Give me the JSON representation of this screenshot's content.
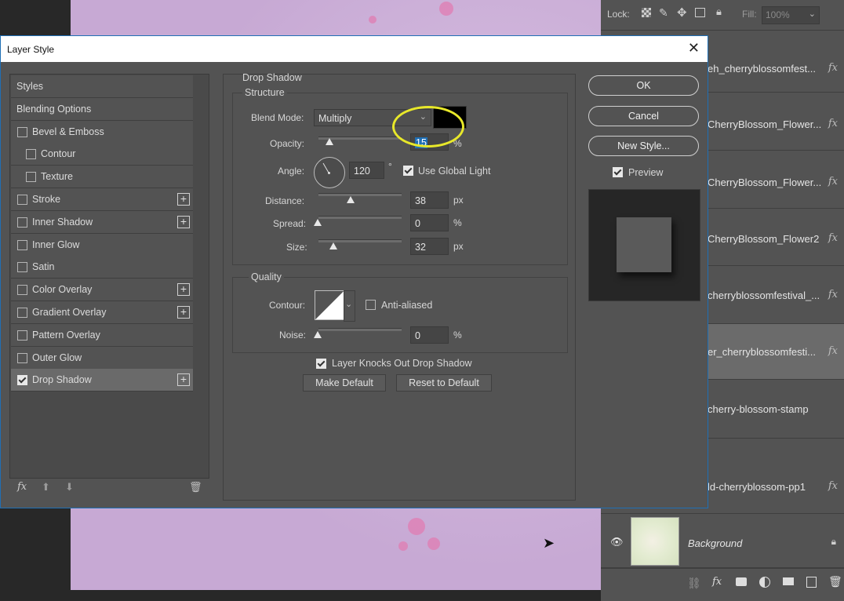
{
  "colors": {
    "dialog_bg": "#535353",
    "accent": "#1f6fb5",
    "highlight_ring": "#e8e82a",
    "canvas": "#cdb3d9",
    "shadow_color": "#000000"
  },
  "layers": {
    "lock_label": "Lock:",
    "fill_label": "Fill:",
    "fill_value": "100%",
    "rows": [
      {
        "name": "eh_cherryblossomfest...",
        "fx": "fx"
      },
      {
        "name": "CherryBlossom_Flower...",
        "fx": "fx"
      },
      {
        "name": "CherryBlossom_Flower...",
        "fx": "fx"
      },
      {
        "name": "CherryBlossom_Flower2",
        "fx": "fx"
      },
      {
        "name": "cherryblossomfestival_...",
        "fx": "fx"
      },
      {
        "name": "er_cherryblossomfesti...",
        "fx": "fx"
      },
      {
        "name": "cherry-blossom-stamp",
        "fx": ""
      },
      {
        "name": "ld-cherryblossom-pp1",
        "fx": "fx"
      },
      {
        "name": "Background",
        "fx": ""
      }
    ]
  },
  "dialog": {
    "title": "Layer Style",
    "styles_list": [
      {
        "label": "Styles",
        "checkbox": false,
        "plus": false,
        "checked": false
      },
      {
        "label": "Blending Options",
        "checkbox": false,
        "plus": false,
        "checked": false
      },
      {
        "label": "Bevel & Emboss",
        "checkbox": true,
        "plus": false,
        "checked": false
      },
      {
        "label": "Contour",
        "checkbox": true,
        "plus": false,
        "checked": false,
        "sub": true
      },
      {
        "label": "Texture",
        "checkbox": true,
        "plus": false,
        "checked": false,
        "sub": true
      },
      {
        "label": "Stroke",
        "checkbox": true,
        "plus": true,
        "checked": false
      },
      {
        "label": "Inner Shadow",
        "checkbox": true,
        "plus": true,
        "checked": false
      },
      {
        "label": "Inner Glow",
        "checkbox": true,
        "plus": false,
        "checked": false
      },
      {
        "label": "Satin",
        "checkbox": true,
        "plus": false,
        "checked": false
      },
      {
        "label": "Color Overlay",
        "checkbox": true,
        "plus": true,
        "checked": false
      },
      {
        "label": "Gradient Overlay",
        "checkbox": true,
        "plus": true,
        "checked": false
      },
      {
        "label": "Pattern Overlay",
        "checkbox": true,
        "plus": false,
        "checked": false
      },
      {
        "label": "Outer Glow",
        "checkbox": true,
        "plus": false,
        "checked": false
      },
      {
        "label": "Drop Shadow",
        "checkbox": true,
        "plus": true,
        "checked": true,
        "active": true
      }
    ],
    "footer_fx": "fx",
    "section_title": "Drop Shadow",
    "structure": {
      "title": "Structure",
      "blend_mode_label": "Blend Mode:",
      "blend_mode_value": "Multiply",
      "opacity_label": "Opacity:",
      "opacity_value": "15",
      "opacity_unit": "%",
      "angle_label": "Angle:",
      "angle_value": "120",
      "angle_unit": "°",
      "global_light_label": "Use Global Light",
      "distance_label": "Distance:",
      "distance_value": "38",
      "distance_unit": "px",
      "spread_label": "Spread:",
      "spread_value": "0",
      "spread_unit": "%",
      "size_label": "Size:",
      "size_value": "32",
      "size_unit": "px"
    },
    "quality": {
      "title": "Quality",
      "contour_label": "Contour:",
      "anti_aliased_label": "Anti-aliased",
      "noise_label": "Noise:",
      "noise_value": "0",
      "noise_unit": "%"
    },
    "knockout_label": "Layer Knocks Out Drop Shadow",
    "make_default": "Make Default",
    "reset_default": "Reset to Default",
    "ok": "OK",
    "cancel": "Cancel",
    "new_style": "New Style...",
    "preview_label": "Preview"
  }
}
